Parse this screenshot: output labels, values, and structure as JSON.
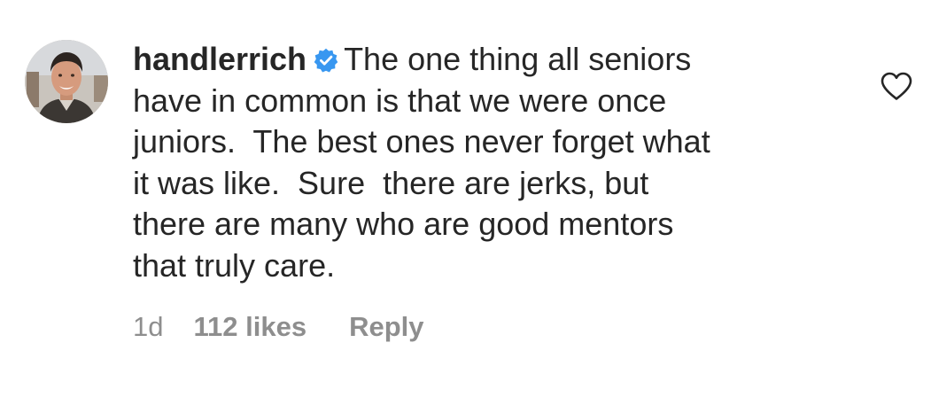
{
  "comment": {
    "avatar_icon": "profile-photo",
    "username": "handlerrich",
    "verified_icon": "verified-badge-icon",
    "verified_color": "#3897f0",
    "text_first_line": "The one thing all seniors",
    "text_lines": [
      "have in common is that we were once",
      "juniors.  The best ones never forget what",
      "it was like.  Sure  there are jerks, but",
      "there are many who are good mentors",
      "that truly care."
    ],
    "time": "1d",
    "likes": "112 likes",
    "reply_label": "Reply",
    "like_icon": "heart-outline-icon"
  }
}
